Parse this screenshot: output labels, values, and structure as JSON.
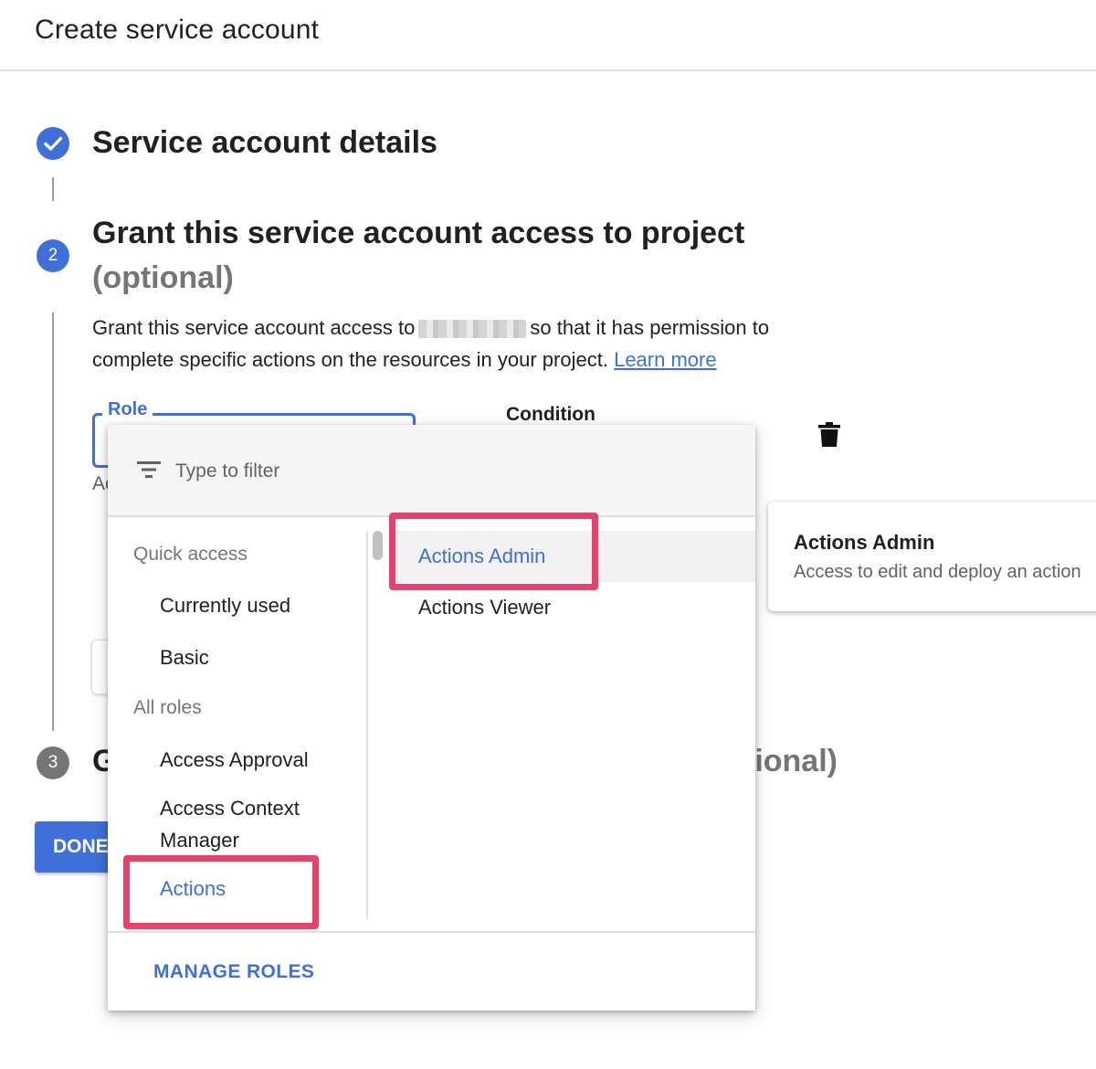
{
  "header": {
    "title": "Create service account"
  },
  "steps": [
    {
      "number": "",
      "title": "Service account details",
      "state": "done"
    },
    {
      "number": "2",
      "title": "Grant this service account access to project",
      "optional": "(optional)",
      "state": "active"
    },
    {
      "number": "3",
      "title_visible_start": "G",
      "title_visible_end": "tional)",
      "state": "pending"
    }
  ],
  "grant": {
    "description_part1": "Grant this service account access to",
    "description_part2": "so that it has permission to complete specific actions on the resources in your project.",
    "learn_more": "Learn more"
  },
  "form": {
    "role_label": "Role",
    "role_hint_visible": "Ac",
    "condition_label": "Condition",
    "done_label": "DONE"
  },
  "dropdown": {
    "filter_placeholder": "Type to filter",
    "quick_access_header": "Quick access",
    "quick_access_items": [
      "Currently used",
      "Basic"
    ],
    "all_roles_header": "All roles",
    "categories": [
      "Access Approval",
      "Access Context Manager",
      "Actions"
    ],
    "selected_category": "Actions",
    "roles": [
      "Actions Admin",
      "Actions Viewer"
    ],
    "active_role": "Actions Admin",
    "manage_roles": "MANAGE ROLES"
  },
  "info_card": {
    "title": "Actions Admin",
    "description": "Access to edit and deploy an action"
  },
  "colors": {
    "accent": "#3f6fd8",
    "highlight": "#e8416b",
    "muted": "#757575"
  }
}
